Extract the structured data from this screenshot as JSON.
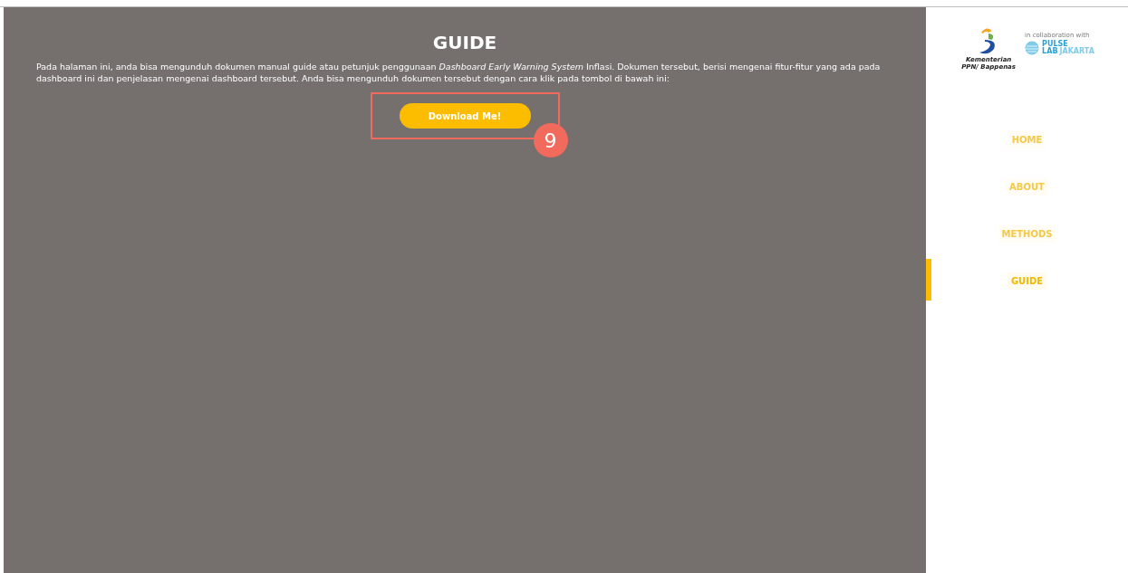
{
  "main": {
    "title": "GUIDE",
    "paragraph": "Pada halaman ini, anda bisa mengunduh dokumen manual guide atau petunjuk penggunaan *Dashboard Early Warning System* Inflasi. Dokumen tersebut, berisi mengenai fitur-fitur yang ada pada dashboard ini dan penjelasan mengenai dashboard tersebut. Anda bisa mengunduh dokumen tersebut dengan cara klik pada tombol di bawah ini:",
    "button": "Download Me!",
    "annotation": "9"
  },
  "sidebar": {
    "logo_left": "Kementerian PPN/ Bappenas",
    "collab": "in collaboration with",
    "logo_right_line1": "PULSE",
    "logo_right_line2a": "LAB",
    "logo_right_line2b": "JAKARTA",
    "items": [
      {
        "label": "HOME",
        "selected": false
      },
      {
        "label": "ABOUT",
        "selected": false
      },
      {
        "label": "METHODS",
        "selected": false
      },
      {
        "label": "GUIDE",
        "selected": true
      }
    ]
  }
}
